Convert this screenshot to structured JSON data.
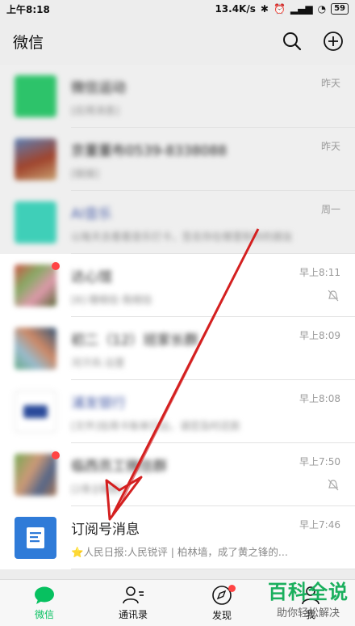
{
  "status": {
    "time": "上午8:18",
    "network": "13.4K/s",
    "battery": "59"
  },
  "header": {
    "title": "微信"
  },
  "chats": [
    {
      "name": "微信运动",
      "preview": "[应用消息]",
      "time": "昨天",
      "pinned": true,
      "muted": false
    },
    {
      "name": "京董董布0539-8338088",
      "preview": "[链接]",
      "time": "昨天",
      "pinned": true,
      "muted": false
    },
    {
      "name": "AI音乐",
      "preview": "以每天去看看音乐打卡，签名你在哪里和你的朋友",
      "time": "周一",
      "pinned": true,
      "muted": false
    },
    {
      "name": "达心馆",
      "preview": "[8]·理相信·我相信",
      "time": "早上8:11",
      "pinned": false,
      "muted": true
    },
    {
      "name": "初二（12）班家长群",
      "preview": "河汗风·沿里",
      "time": "早上8:09",
      "pinned": false,
      "muted": false
    },
    {
      "name": "浦发银行",
      "preview": "[文件]信用卡账单已出，请您及时还款",
      "time": "早上8:08",
      "pinned": false,
      "muted": false
    },
    {
      "name": "临西员工微信群",
      "preview": "[2条][相册]",
      "time": "早上7:50",
      "pinned": false,
      "muted": true
    },
    {
      "name": "订阅号消息",
      "preview": "⭐人民日报:人民锐评 | 柏林墙，成了黄之锋的...",
      "time": "早上7:46",
      "pinned": false,
      "muted": false
    }
  ],
  "tabs": [
    {
      "label": "微信"
    },
    {
      "label": "通讯录"
    },
    {
      "label": "发现"
    },
    {
      "label": "我"
    }
  ],
  "watermark": {
    "main": "百科全说",
    "sub": "助你轻松解决"
  },
  "colors": {
    "accent": "#07c160",
    "arrow": "#d42020"
  }
}
